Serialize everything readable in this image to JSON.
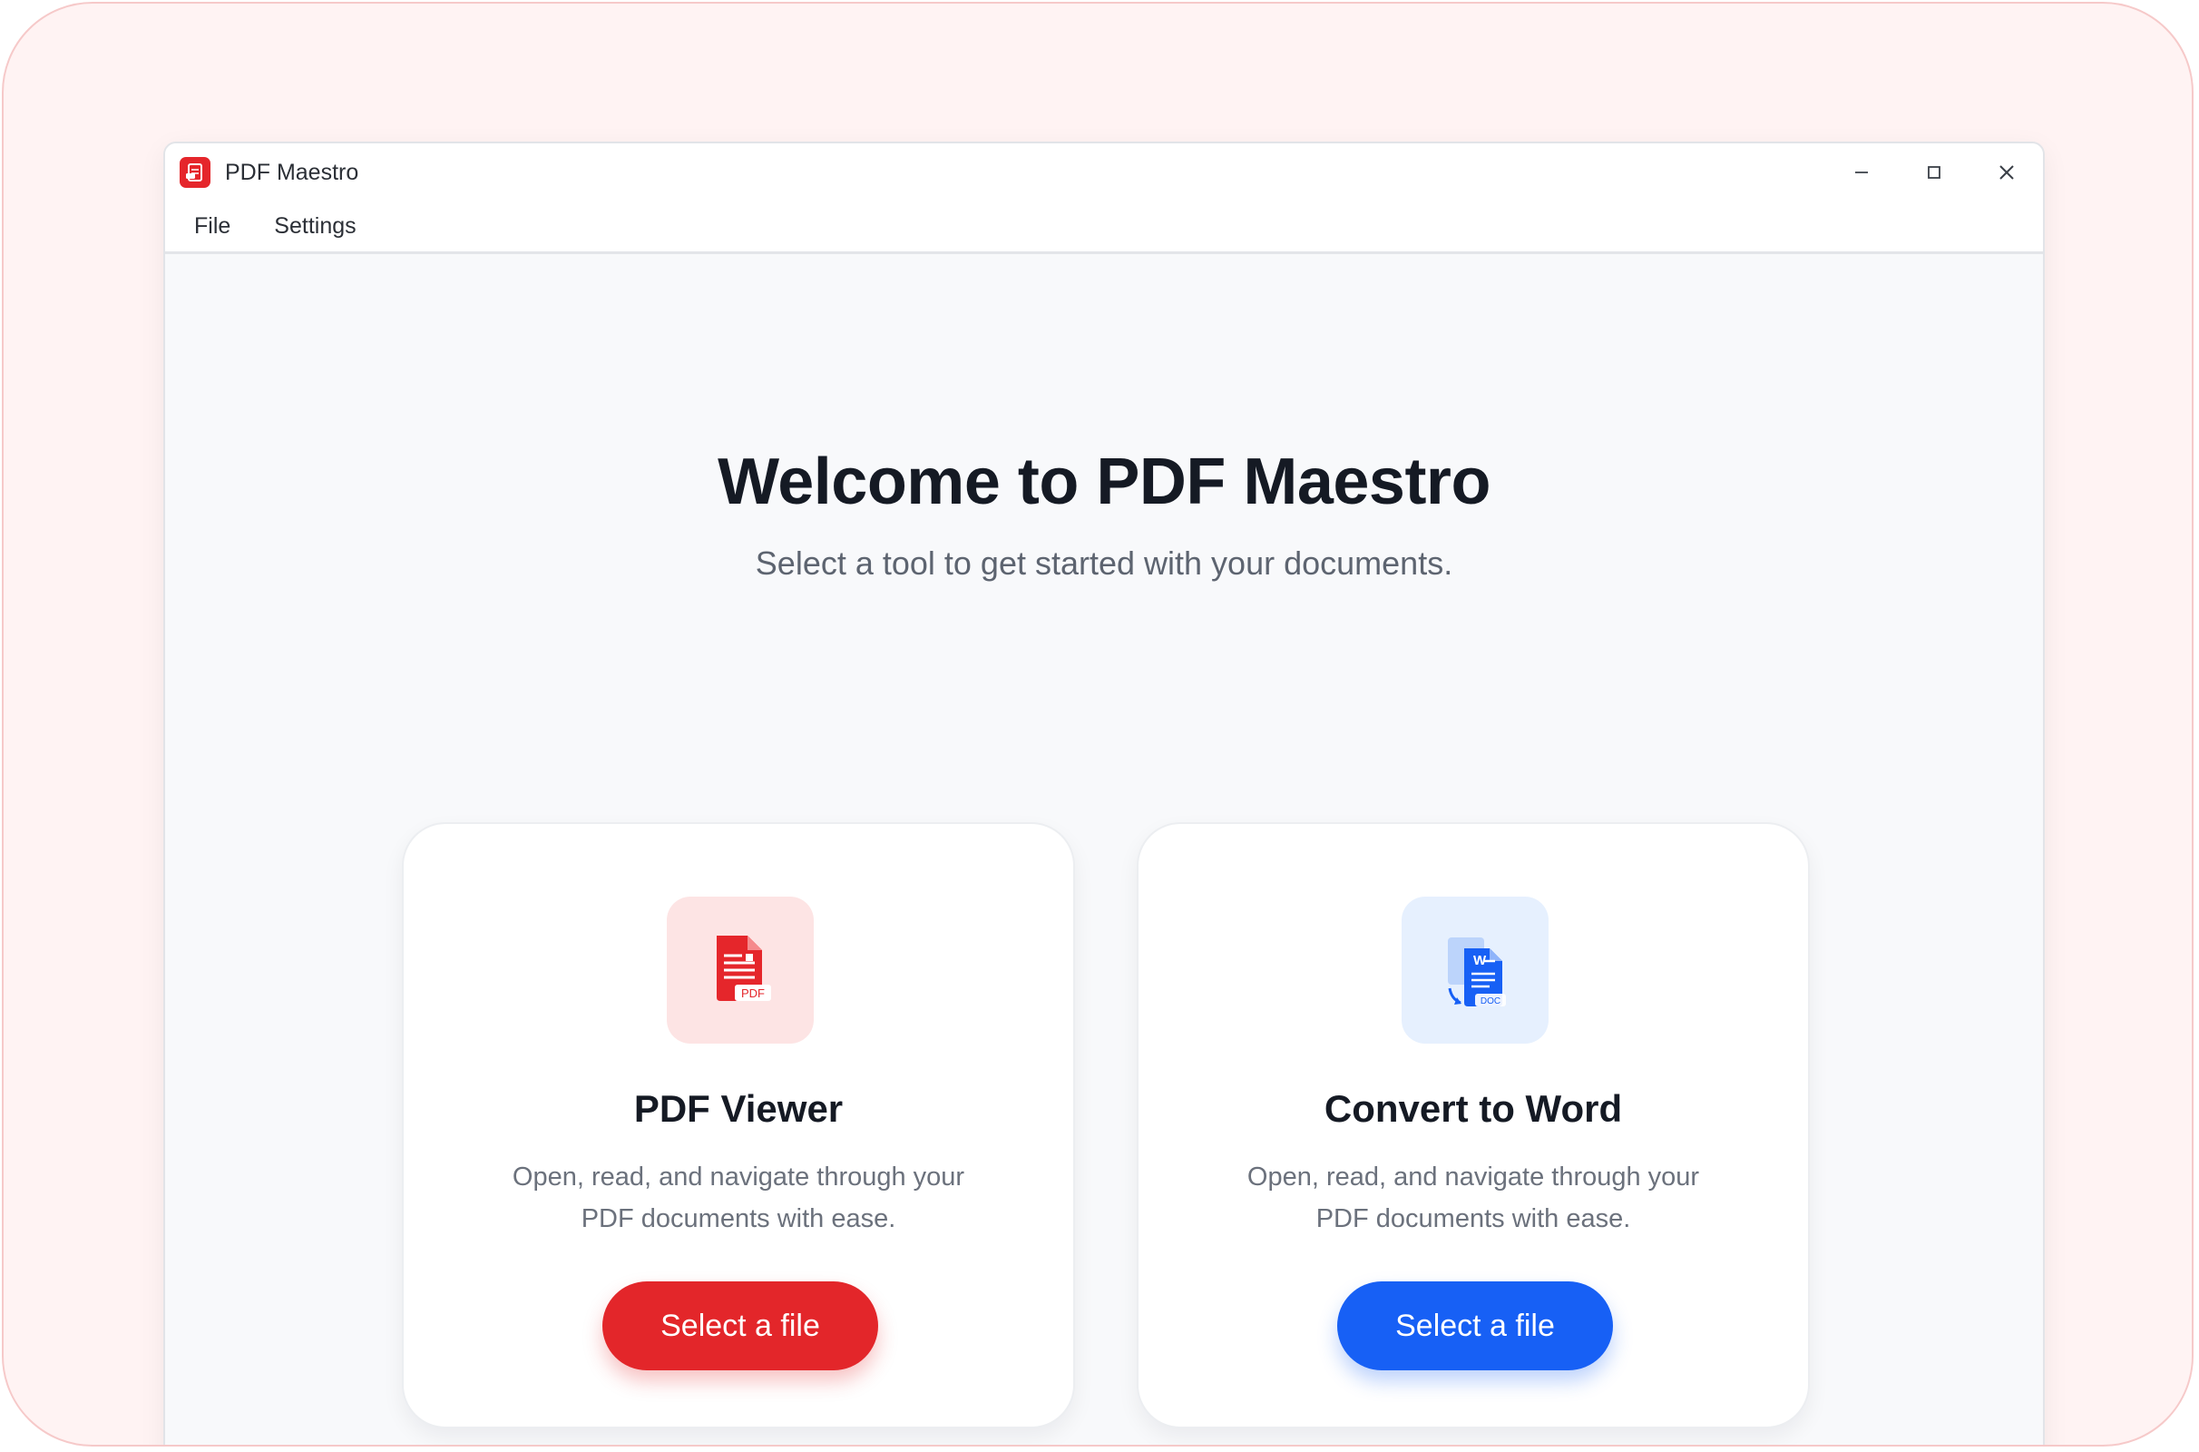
{
  "window": {
    "title": "PDF Maestro"
  },
  "menu": {
    "items": [
      "File",
      "Settings"
    ]
  },
  "welcome": {
    "title": "Welcome to PDF Maestro",
    "subtitle": "Select a tool to get started with your documents."
  },
  "cards": [
    {
      "title": "PDF Viewer",
      "description": "Open, read, and navigate through your PDF documents with ease.",
      "button_label": "Select a file",
      "icon": "pdf-file-icon",
      "icon_badge": "PDF",
      "accent": "#e3262a"
    },
    {
      "title": "Convert to Word",
      "description": "Open, read, and navigate through your PDF documents with ease.",
      "button_label": "Select a file",
      "icon": "word-doc-icon",
      "icon_badge": "DOC",
      "icon_letter": "W",
      "accent": "#1760f5"
    }
  ],
  "icons": {
    "app": "pdf-maestro-logo-icon",
    "minimize": "minimize-icon",
    "maximize": "maximize-icon",
    "close": "close-icon"
  }
}
